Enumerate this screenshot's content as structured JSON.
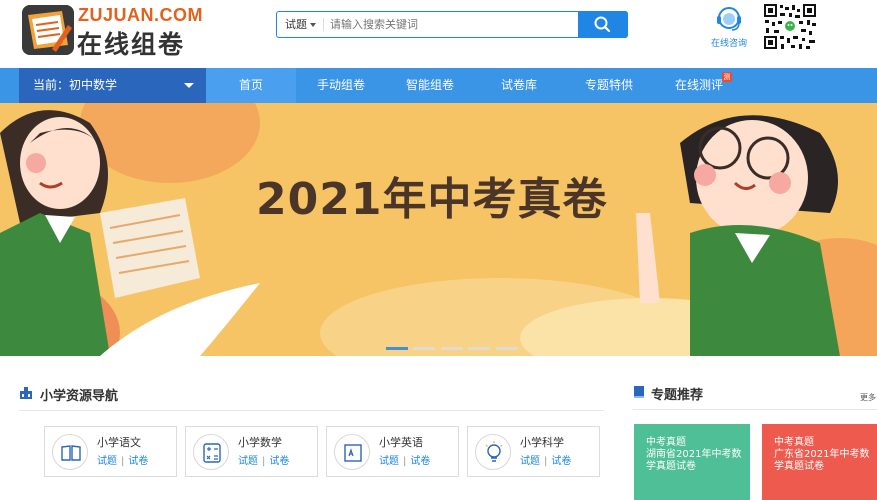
{
  "header": {
    "logo_top": "ZUJUAN.COM",
    "logo_bottom": "在线组卷",
    "search": {
      "type_label": "试题",
      "placeholder": "请输入搜索关键词",
      "button_icon": "search-icon"
    },
    "consult_label": "在线咨询"
  },
  "nav": {
    "current_label": "当前：初中数学",
    "items": [
      {
        "label": "首页",
        "active": true
      },
      {
        "label": "手动组卷"
      },
      {
        "label": "智能组卷"
      },
      {
        "label": "试卷库"
      },
      {
        "label": "专题特供"
      },
      {
        "label": "在线测评",
        "badge": "测"
      }
    ]
  },
  "banner": {
    "title": "2021年中考真卷",
    "slides": 5,
    "active_slide": 1
  },
  "resources": {
    "title": "小学资源导航",
    "cards": [
      {
        "title": "小学语文",
        "link1": "试题",
        "link2": "试卷",
        "icon": "book-icon"
      },
      {
        "title": "小学数学",
        "link1": "试题",
        "link2": "试卷",
        "icon": "calculator-icon"
      },
      {
        "title": "小学英语",
        "link1": "试题",
        "link2": "试卷",
        "icon": "abc-icon"
      },
      {
        "title": "小学科学",
        "link1": "试题",
        "link2": "试卷",
        "icon": "bulb-icon"
      }
    ]
  },
  "topics": {
    "title": "专题推荐",
    "more": "更多",
    "cards": [
      {
        "tag": "中考真题",
        "name": "湖南省2021年中考数学真题试卷",
        "color": "#4fbf97"
      },
      {
        "tag": "中考真题",
        "name": "广东省2021年中考数学真题试卷",
        "color": "#ee5a4e"
      }
    ]
  },
  "colors": {
    "brand_blue": "#1f86e6",
    "nav_bg": "#3b95e6",
    "nav_current": "#2a66bb",
    "banner_bg": "#f6c465",
    "logo_orange": "#e2621c"
  }
}
